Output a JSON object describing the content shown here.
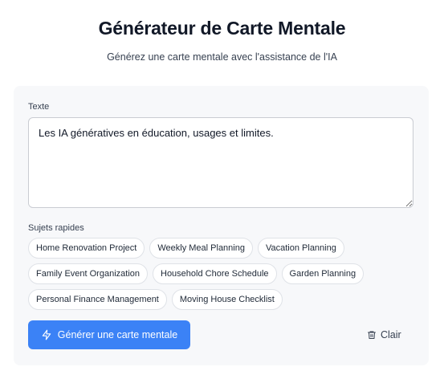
{
  "header": {
    "title": "Générateur de Carte Mentale",
    "subtitle": "Générez une carte mentale avec l'assistance de l'IA"
  },
  "form": {
    "text_label": "Texte",
    "text_value": "Les IA génératives en éducation, usages et limites.",
    "quick_topics_label": "Sujets rapides",
    "quick_topics": [
      [
        "Home Renovation Project",
        "Weekly Meal Planning",
        "Vacation Planning"
      ],
      [
        "Family Event Organization",
        "Household Chore Schedule",
        "Garden Planning"
      ],
      [
        "Personal Finance Management",
        "Moving House Checklist"
      ]
    ],
    "generate_label": "Générer une carte mentale",
    "clear_label": "Clair"
  },
  "icons": {
    "generate": "lightning-bolt-icon",
    "clear": "trash-icon"
  },
  "colors": {
    "accent": "#3b82f6",
    "card_bg": "#f7f8fa"
  }
}
